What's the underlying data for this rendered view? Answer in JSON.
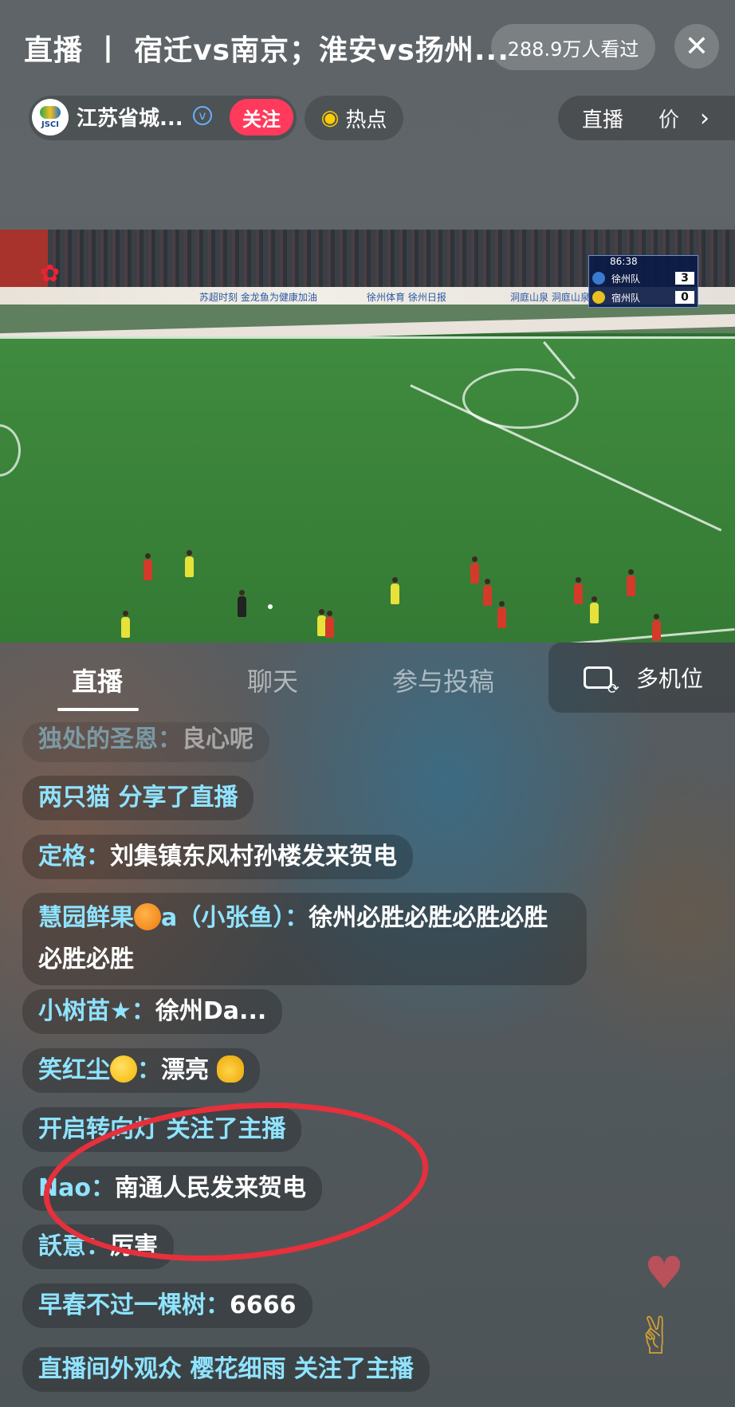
{
  "header": {
    "title": "直播 丨 宿迁vs南京；淮安vs扬州...",
    "views": "288.9万人看过",
    "close_icon": "close-icon"
  },
  "channel": {
    "logo_text": "JSCI",
    "name": "江苏省城...",
    "verified_icon": "verified-icon",
    "follow_label": "关注",
    "hot_label": "热点",
    "right_label_1": "直播",
    "right_label_2": "价"
  },
  "video": {
    "time": "86:38",
    "team1": "徐州队",
    "score1": "3",
    "team2": "宿州队",
    "score2": "0",
    "ad1": "苏超时刻 金龙鱼为健康加油",
    "ad2": "徐州体育  徐州日报",
    "ad3": "洞庭山泉 洞庭山泉"
  },
  "tabs": {
    "live": "直播",
    "chat": "聊天",
    "submit": "参与投稿",
    "multicam": "多机位"
  },
  "chat": [
    {
      "user": "独处的圣恩：",
      "text": "良心呢"
    },
    {
      "user": "两只猫 分享了直播",
      "text": ""
    },
    {
      "user": "定格：",
      "text": "刘集镇东风村孙楼发来贺电"
    },
    {
      "user": "慧园鲜果",
      "user2": "a（小张鱼）：",
      "text": "徐州必胜必胜必胜必胜必胜必胜"
    },
    {
      "user": "小树苗★：",
      "text": "徐州Da..."
    },
    {
      "user": "笑红尘",
      "user2": "：",
      "text": "漂亮"
    },
    {
      "user": "开启转向灯 关注了主播",
      "text": ""
    },
    {
      "user": "Nao：",
      "text": "南通人民发来贺电"
    },
    {
      "user": "訞意：",
      "text": "厉害"
    },
    {
      "user": "早春不过一棵树：",
      "text": "6666"
    },
    {
      "user": "直播间外观众 樱花细雨 关注了主播",
      "text": ""
    }
  ]
}
